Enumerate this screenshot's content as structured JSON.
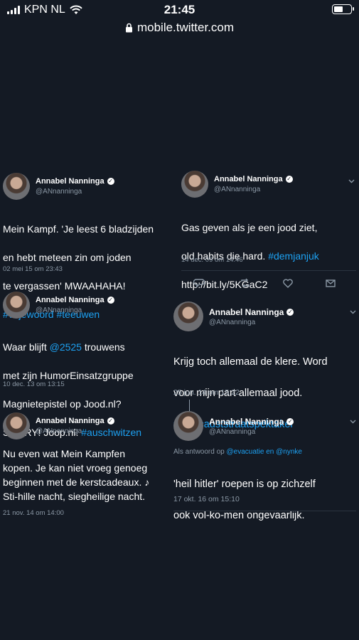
{
  "status_bar": {
    "carrier": "KPN NL",
    "time": "21:45"
  },
  "url_bar": {
    "url": "mobile.twitter.com"
  },
  "tweets": [
    {
      "name": "Annabel Nanninga",
      "handle": "@ANnanninga",
      "lines": [
        {
          "text": "Mein Kampf. 'Je leest 6 bladzijden"
        },
        {
          "text": "en hebt meteen zin om joden"
        },
        {
          "text": "te vergassen' MWAAHAHA!"
        }
      ],
      "hashtags": "#vrijewoord #teeuwen",
      "time": "02 mei 15 om 23:43"
    },
    {
      "name": "Annabel Nanninga",
      "handle": "@ANnanninga",
      "line1": "Gas geven als je een jood ziet,",
      "line2_plain": "old habits die hard. ",
      "line2_tag": "#demjanjuk",
      "line3": "http://bit.ly/5KGaC2",
      "time": "14 dec. 09 om 14:46"
    },
    {
      "name": "Annabel Nanninga",
      "handle": "@ANnanninga",
      "line1_plain": "Waar blijft ",
      "line1_tag": "@2525",
      "line1_rest": " trouwens",
      "line2": "met zijn HumorEinsatzgruppe",
      "line3": "Magnietepistel op Jood.nl?",
      "line4_plain": "SORRY! Joop.nl! ",
      "line4_tag": "#auschwitzen",
      "time": "10 dec. 13 om 13:15"
    },
    {
      "name": "Annabel Nanninga",
      "handle": "@ANnanninga",
      "line1": "Krijg toch allemaal de klere. Word",
      "line2": "voor mijn part allemaal jood.",
      "line3_tag": "#holocauststraatspektakel",
      "time": "25 jun. 14 om 15:22"
    },
    {
      "name": "Annabel Nanninga",
      "handle": "@ANnanninga",
      "line1": "Nu even wat Mein Kampfen",
      "line2": "kopen. Je kan niet vroeg genoeg",
      "line3": "beginnen met de kerstcadeaux. ♪",
      "line4": "Sti-hille nacht, siegheilige nacht.",
      "time": "21 nov. 14 om 14:00"
    },
    {
      "name": "Annabel Nanninga",
      "handle": "@ANnanninga",
      "reply_prefix": "Als antwoord op ",
      "reply_targets": "@evacuatie en @nynke",
      "line1": "'heil hitler' roepen is op zichzelf",
      "line2": "ook vol-ko-men ongevaarlijk.",
      "time": "17 okt. 16 om 15:10"
    }
  ]
}
